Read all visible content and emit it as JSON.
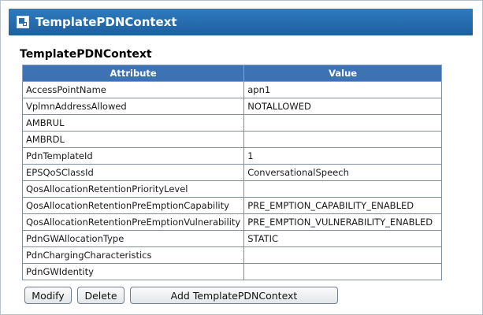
{
  "panel": {
    "title": "TemplatePDNContext",
    "icon": "window-icon",
    "section_title": "TemplatePDNContext"
  },
  "table": {
    "headers": [
      "Attribute",
      "Value"
    ],
    "rows": [
      {
        "attribute": "AccessPointName",
        "value": "apn1"
      },
      {
        "attribute": "VplmnAddressAllowed",
        "value": "NOTALLOWED"
      },
      {
        "attribute": "AMBRUL",
        "value": ""
      },
      {
        "attribute": "AMBRDL",
        "value": ""
      },
      {
        "attribute": "PdnTemplateId",
        "value": "1"
      },
      {
        "attribute": "EPSQoSClassId",
        "value": "ConversationalSpeech"
      },
      {
        "attribute": "QosAllocationRetentionPriorityLevel",
        "value": ""
      },
      {
        "attribute": "QosAllocationRetentionPreEmptionCapability",
        "value": "PRE_EMPTION_CAPABILITY_ENABLED"
      },
      {
        "attribute": "QosAllocationRetentionPreEmptionVulnerability",
        "value": "PRE_EMPTION_VULNERABILITY_ENABLED"
      },
      {
        "attribute": "PdnGWAllocationType",
        "value": "STATIC"
      },
      {
        "attribute": "PdnChargingCharacteristics",
        "value": ""
      },
      {
        "attribute": "PdnGWIdentity",
        "value": ""
      }
    ]
  },
  "buttons": {
    "modify": "Modify",
    "delete": "Delete",
    "add": "Add TemplatePDNContext"
  },
  "colors": {
    "titlebar": "#2a6cad",
    "table_header": "#3d73b5"
  }
}
